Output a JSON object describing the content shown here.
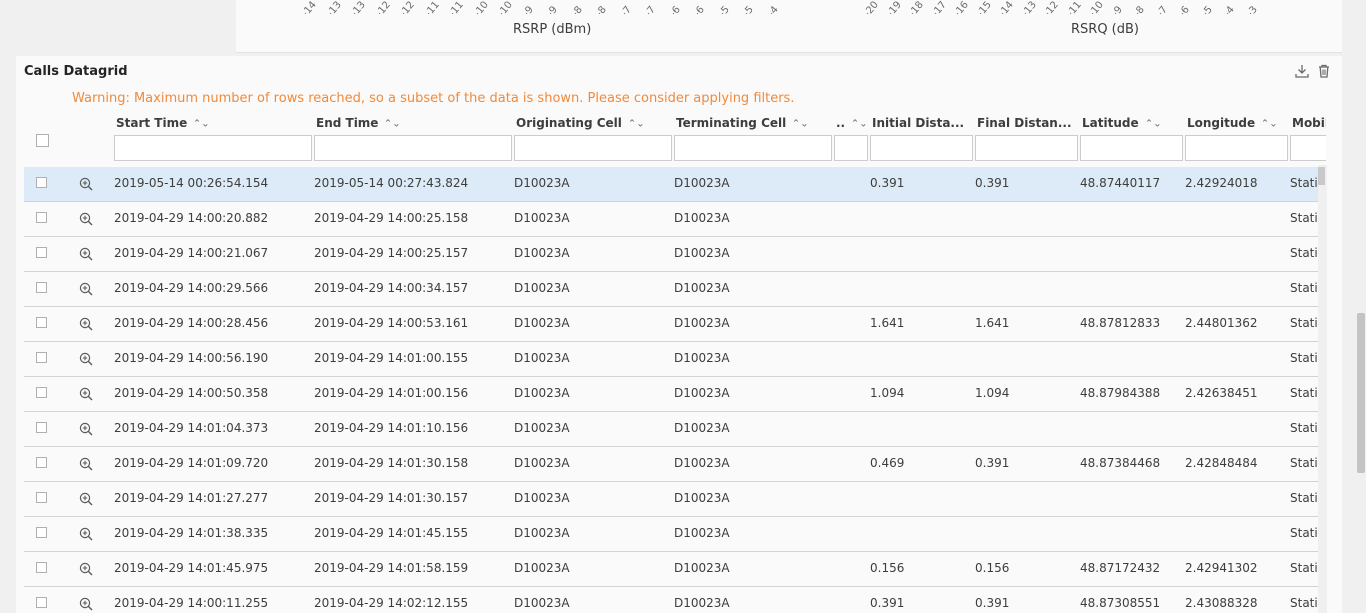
{
  "chart_strip": {
    "rsrp_ticks": [
      "-14",
      "-13",
      "-13",
      "-12",
      "-12",
      "-11",
      "-11",
      "-10",
      "-10",
      "-9",
      "-9",
      "-8",
      "-8",
      "-7",
      "-7",
      "-6",
      "-6",
      "-5",
      "-5",
      "-4"
    ],
    "rsrq_ticks": [
      "-20",
      "-19",
      "-18",
      "-17",
      "-16",
      "-15",
      "-14",
      "-13",
      "-12",
      "-11",
      "-10",
      "-9",
      "-8",
      "-7",
      "-6",
      "-5",
      "-4",
      "-3"
    ],
    "rsrp_label": "RSRP (dBm)",
    "rsrq_label": "RSRQ (dB)"
  },
  "panel": {
    "title": "Calls Datagrid",
    "warning": "Warning: Maximum number of rows reached, so a subset of the data is shown. Please consider applying filters.",
    "icons": [
      "download-icon",
      "trash-icon"
    ]
  },
  "columns": [
    {
      "key": "start",
      "label": "Start Time"
    },
    {
      "key": "end",
      "label": "End Time"
    },
    {
      "key": "orig",
      "label": "Originating Cell"
    },
    {
      "key": "term",
      "label": "Terminating Cell"
    },
    {
      "key": "narrow",
      "label": ".."
    },
    {
      "key": "idist",
      "label": "Initial Dista..."
    },
    {
      "key": "fdist",
      "label": "Final Distan..."
    },
    {
      "key": "lat",
      "label": "Latitude"
    },
    {
      "key": "lon",
      "label": "Longitude"
    },
    {
      "key": "mob",
      "label": "Mobility"
    }
  ],
  "sort_glyph": "⌃⌄",
  "rows": [
    {
      "start": "2019-05-14 00:26:54.154",
      "end": "2019-05-14 00:27:43.824",
      "orig": "D10023A",
      "term": "D10023A",
      "idist": "0.391",
      "fdist": "0.391",
      "lat": "48.87440117",
      "lon": "2.42924018",
      "mob": "Static",
      "selected": true
    },
    {
      "start": "2019-04-29 14:00:20.882",
      "end": "2019-04-29 14:00:25.158",
      "orig": "D10023A",
      "term": "D10023A",
      "idist": "",
      "fdist": "",
      "lat": "",
      "lon": "",
      "mob": "Static"
    },
    {
      "start": "2019-04-29 14:00:21.067",
      "end": "2019-04-29 14:00:25.157",
      "orig": "D10023A",
      "term": "D10023A",
      "idist": "",
      "fdist": "",
      "lat": "",
      "lon": "",
      "mob": "Static"
    },
    {
      "start": "2019-04-29 14:00:29.566",
      "end": "2019-04-29 14:00:34.157",
      "orig": "D10023A",
      "term": "D10023A",
      "idist": "",
      "fdist": "",
      "lat": "",
      "lon": "",
      "mob": "Static"
    },
    {
      "start": "2019-04-29 14:00:28.456",
      "end": "2019-04-29 14:00:53.161",
      "orig": "D10023A",
      "term": "D10023A",
      "idist": "1.641",
      "fdist": "1.641",
      "lat": "48.87812833",
      "lon": "2.44801362",
      "mob": "Static"
    },
    {
      "start": "2019-04-29 14:00:56.190",
      "end": "2019-04-29 14:01:00.155",
      "orig": "D10023A",
      "term": "D10023A",
      "idist": "",
      "fdist": "",
      "lat": "",
      "lon": "",
      "mob": "Static"
    },
    {
      "start": "2019-04-29 14:00:50.358",
      "end": "2019-04-29 14:01:00.156",
      "orig": "D10023A",
      "term": "D10023A",
      "idist": "1.094",
      "fdist": "1.094",
      "lat": "48.87984388",
      "lon": "2.42638451",
      "mob": "Static"
    },
    {
      "start": "2019-04-29 14:01:04.373",
      "end": "2019-04-29 14:01:10.156",
      "orig": "D10023A",
      "term": "D10023A",
      "idist": "",
      "fdist": "",
      "lat": "",
      "lon": "",
      "mob": "Static"
    },
    {
      "start": "2019-04-29 14:01:09.720",
      "end": "2019-04-29 14:01:30.158",
      "orig": "D10023A",
      "term": "D10023A",
      "idist": "0.469",
      "fdist": "0.391",
      "lat": "48.87384468",
      "lon": "2.42848484",
      "mob": "Static"
    },
    {
      "start": "2019-04-29 14:01:27.277",
      "end": "2019-04-29 14:01:30.157",
      "orig": "D10023A",
      "term": "D10023A",
      "idist": "",
      "fdist": "",
      "lat": "",
      "lon": "",
      "mob": "Static"
    },
    {
      "start": "2019-04-29 14:01:38.335",
      "end": "2019-04-29 14:01:45.155",
      "orig": "D10023A",
      "term": "D10023A",
      "idist": "",
      "fdist": "",
      "lat": "",
      "lon": "",
      "mob": "Static"
    },
    {
      "start": "2019-04-29 14:01:45.975",
      "end": "2019-04-29 14:01:58.159",
      "orig": "D10023A",
      "term": "D10023A",
      "idist": "0.156",
      "fdist": "0.156",
      "lat": "48.87172432",
      "lon": "2.42941302",
      "mob": "Static"
    },
    {
      "start": "2019-04-29 14:00:11.255",
      "end": "2019-04-29 14:02:12.155",
      "orig": "D10023A",
      "term": "D10023A",
      "idist": "0.391",
      "fdist": "0.391",
      "lat": "48.87308551",
      "lon": "2.43088328",
      "mob": "Static"
    }
  ],
  "colors": {
    "warning": "#f08a3c",
    "selected_row": "#dcebf7"
  }
}
